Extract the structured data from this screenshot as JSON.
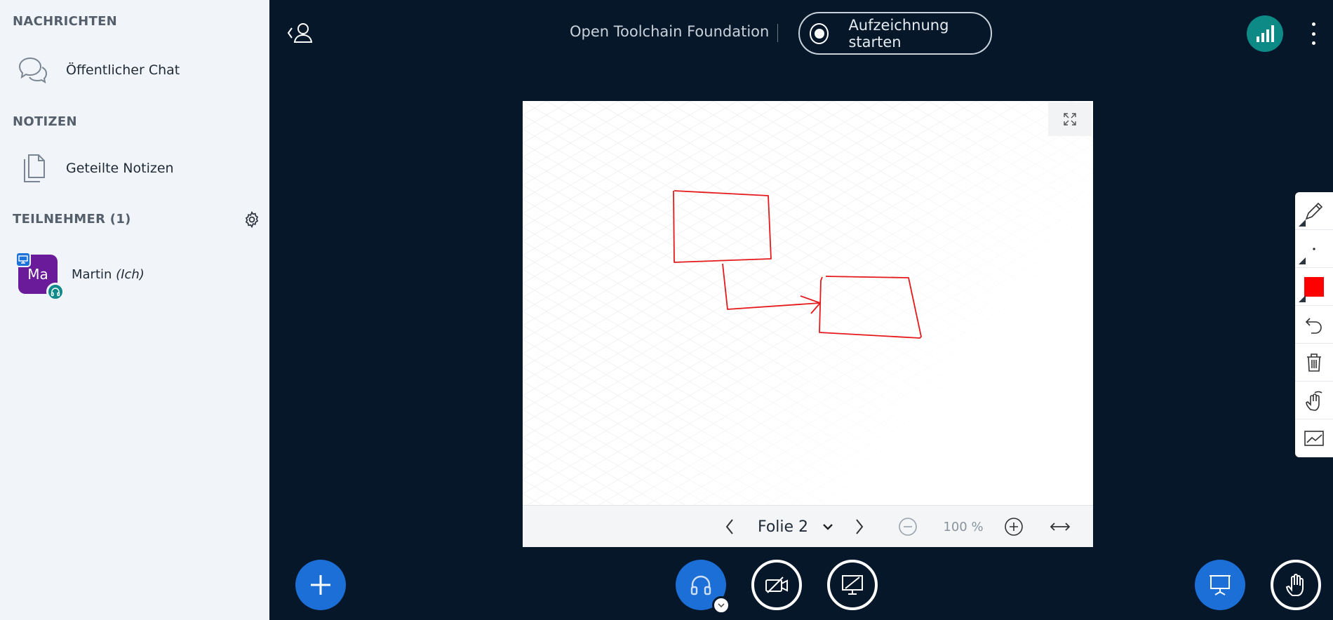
{
  "sidebar": {
    "messages_title": "NACHRICHTEN",
    "public_chat": "Öffentlicher Chat",
    "notes_title": "NOTIZEN",
    "shared_notes": "Geteilte Notizen",
    "participants_title": "TEILNEHMER (1)",
    "user": {
      "initials": "Ma",
      "name": "Martin",
      "suffix": "(Ich)",
      "avatar_color": "#6a1b9a"
    }
  },
  "header": {
    "meeting_title": "Open Toolchain Foundation",
    "record_label": "Aufzeichnung starten"
  },
  "presentation": {
    "slide_label": "Folie 2",
    "zoom": "100 %"
  },
  "colors": {
    "background": "#06172a",
    "accent": "#1b6fd6",
    "connection": "#0e8a86",
    "drawing": "#e5191b",
    "selected_color_swatch": "#ff0000"
  },
  "icons": [
    "user-list-icon",
    "chat-icon",
    "notes-icon",
    "gear-icon",
    "record-icon",
    "signal-icon",
    "more-icon",
    "fullscreen-icon",
    "chevron-left-icon",
    "chevron-down-icon",
    "chevron-right-icon",
    "zoom-out-icon",
    "zoom-in-icon",
    "fit-width-icon",
    "pencil-icon",
    "dot-icon",
    "color-swatch-icon",
    "undo-icon",
    "trash-icon",
    "hand-pan-icon",
    "whiteboard-multiuser-icon",
    "plus-icon",
    "headphones-icon",
    "camera-off-icon",
    "screenshare-off-icon",
    "presentation-icon",
    "raise-hand-icon"
  ]
}
